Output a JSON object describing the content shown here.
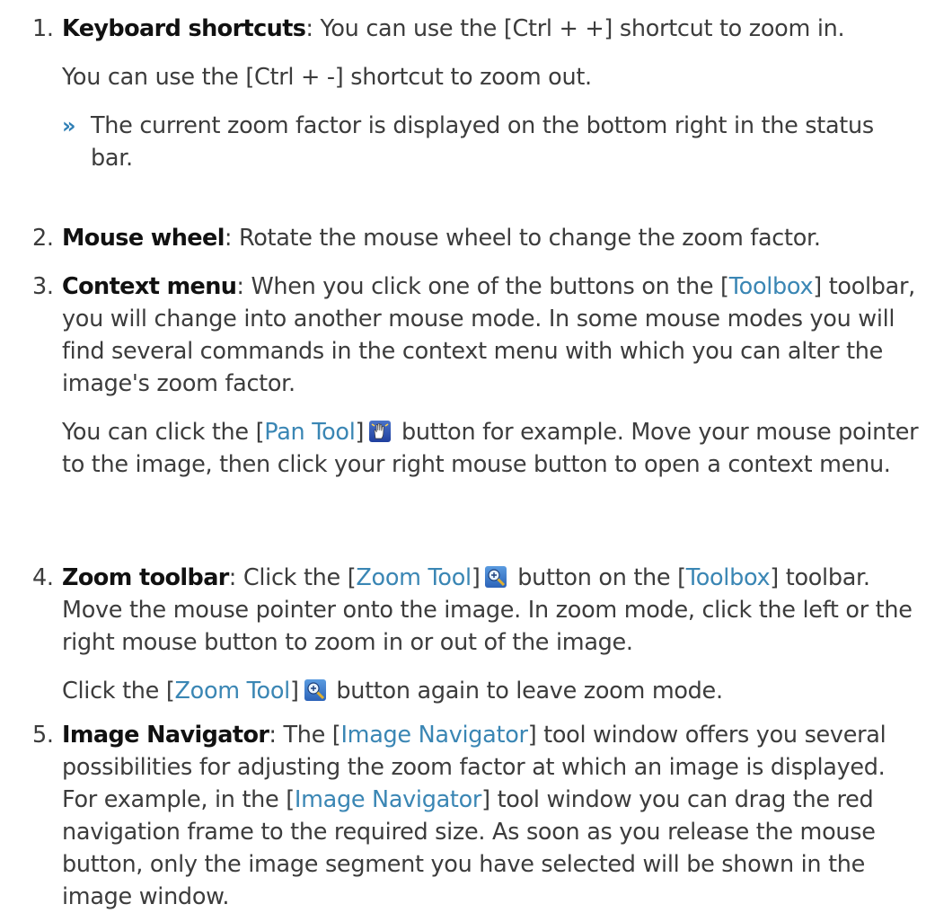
{
  "items": [
    {
      "number": "1.",
      "term": "Keyboard shortcuts",
      "text": ": You can use the [Ctrl + +] shortcut to zoom in.",
      "para2": "You can use the [Ctrl + -] shortcut to zoom out.",
      "result_marker": "»",
      "result": "The current zoom factor is displayed on the bottom right in the status bar."
    },
    {
      "number": "2.",
      "term": "Mouse wheel",
      "text": ": Rotate the mouse wheel to change the zoom factor."
    },
    {
      "number": "3.",
      "term": "Context menu",
      "text_a": ": When you click one of the buttons on the [",
      "link_a": "Toolbox",
      "text_b": "] toolbar, you will change into another mouse mode. In some mouse modes you will find several commands in the context menu with which you can alter the image's zoom factor.",
      "para2_a": "You can click the [",
      "para2_link": "Pan Tool",
      "para2_b": "]",
      "para2_icon": "pan-hand-icon",
      "para2_c": " button for example. Move your mouse pointer to the image, then click your right mouse button to open a context menu."
    },
    {
      "number": "4.",
      "term": "Zoom toolbar",
      "text_a": ": Click the [",
      "link_a": "Zoom Tool",
      "text_b": "]",
      "icon": "zoom-tool-icon",
      "text_c": " button on the [",
      "link_b": "Toolbox",
      "text_d": "] toolbar. Move the mouse pointer onto the image. In zoom mode, click the left or the right mouse button to zoom in or out of the image.",
      "para2_a": "Click the [",
      "para2_link": "Zoom Tool",
      "para2_b": "]",
      "para2_icon": "zoom-tool-icon",
      "para2_c": " button again to leave zoom mode."
    },
    {
      "number": "5.",
      "term": "Image Navigator",
      "text_a": ": The [",
      "link_a": "Image Navigator",
      "text_b": "] tool window offers you several possibilities for adjusting the zoom factor at which an image is displayed. For example, in the [",
      "link_b": "Image Navigator",
      "text_c": "] tool window you can drag the red navigation frame to the required size. As soon as you release the mouse button, only the image segment you have selected will be shown in the image window."
    }
  ],
  "colors": {
    "text": "#3c3c3c",
    "term": "#111111",
    "link": "#3a86b4",
    "marker": "#2f7fb5"
  }
}
